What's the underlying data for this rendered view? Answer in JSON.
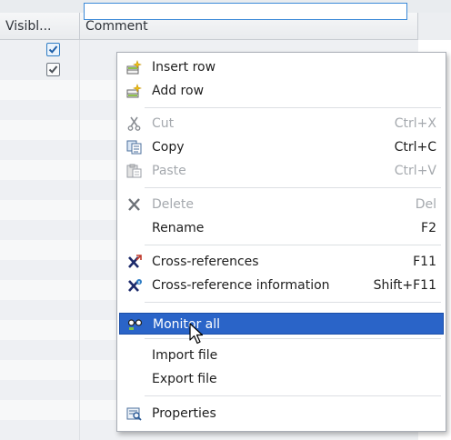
{
  "table": {
    "columns": [
      "Visibl...",
      "Comment"
    ],
    "rows": [
      {
        "visible": true,
        "comment": ""
      },
      {
        "visible": true,
        "comment": ""
      }
    ]
  },
  "context_menu": {
    "items": [
      {
        "label": "Insert row",
        "shortcut": "",
        "icon": "insert-row-icon",
        "enabled": true
      },
      {
        "label": "Add row",
        "shortcut": "",
        "icon": "add-row-icon",
        "enabled": true
      },
      {
        "label": "Cut",
        "shortcut": "Ctrl+X",
        "icon": "cut-icon",
        "enabled": false
      },
      {
        "label": "Copy",
        "shortcut": "Ctrl+C",
        "icon": "copy-icon",
        "enabled": true
      },
      {
        "label": "Paste",
        "shortcut": "Ctrl+V",
        "icon": "paste-icon",
        "enabled": false
      },
      {
        "label": "Delete",
        "shortcut": "Del",
        "icon": "delete-icon",
        "enabled": false
      },
      {
        "label": "Rename",
        "shortcut": "F2",
        "icon": "",
        "enabled": true
      },
      {
        "label": "Cross-references",
        "shortcut": "F11",
        "icon": "cross-references-icon",
        "enabled": true
      },
      {
        "label": "Cross-reference information",
        "shortcut": "Shift+F11",
        "icon": "cross-reference-info-icon",
        "enabled": true
      },
      {
        "label": "Monitor all",
        "shortcut": "",
        "icon": "monitor-all-icon",
        "enabled": true,
        "highlighted": true
      },
      {
        "label": "Import file",
        "shortcut": "",
        "icon": "",
        "enabled": true
      },
      {
        "label": "Export file",
        "shortcut": "",
        "icon": "",
        "enabled": true
      },
      {
        "label": "Properties",
        "shortcut": "",
        "icon": "properties-icon",
        "enabled": true
      }
    ]
  },
  "colors": {
    "highlight": "#2a64c8",
    "accent": "#3c8ad8",
    "disabled_text": "#a5a9ae"
  }
}
